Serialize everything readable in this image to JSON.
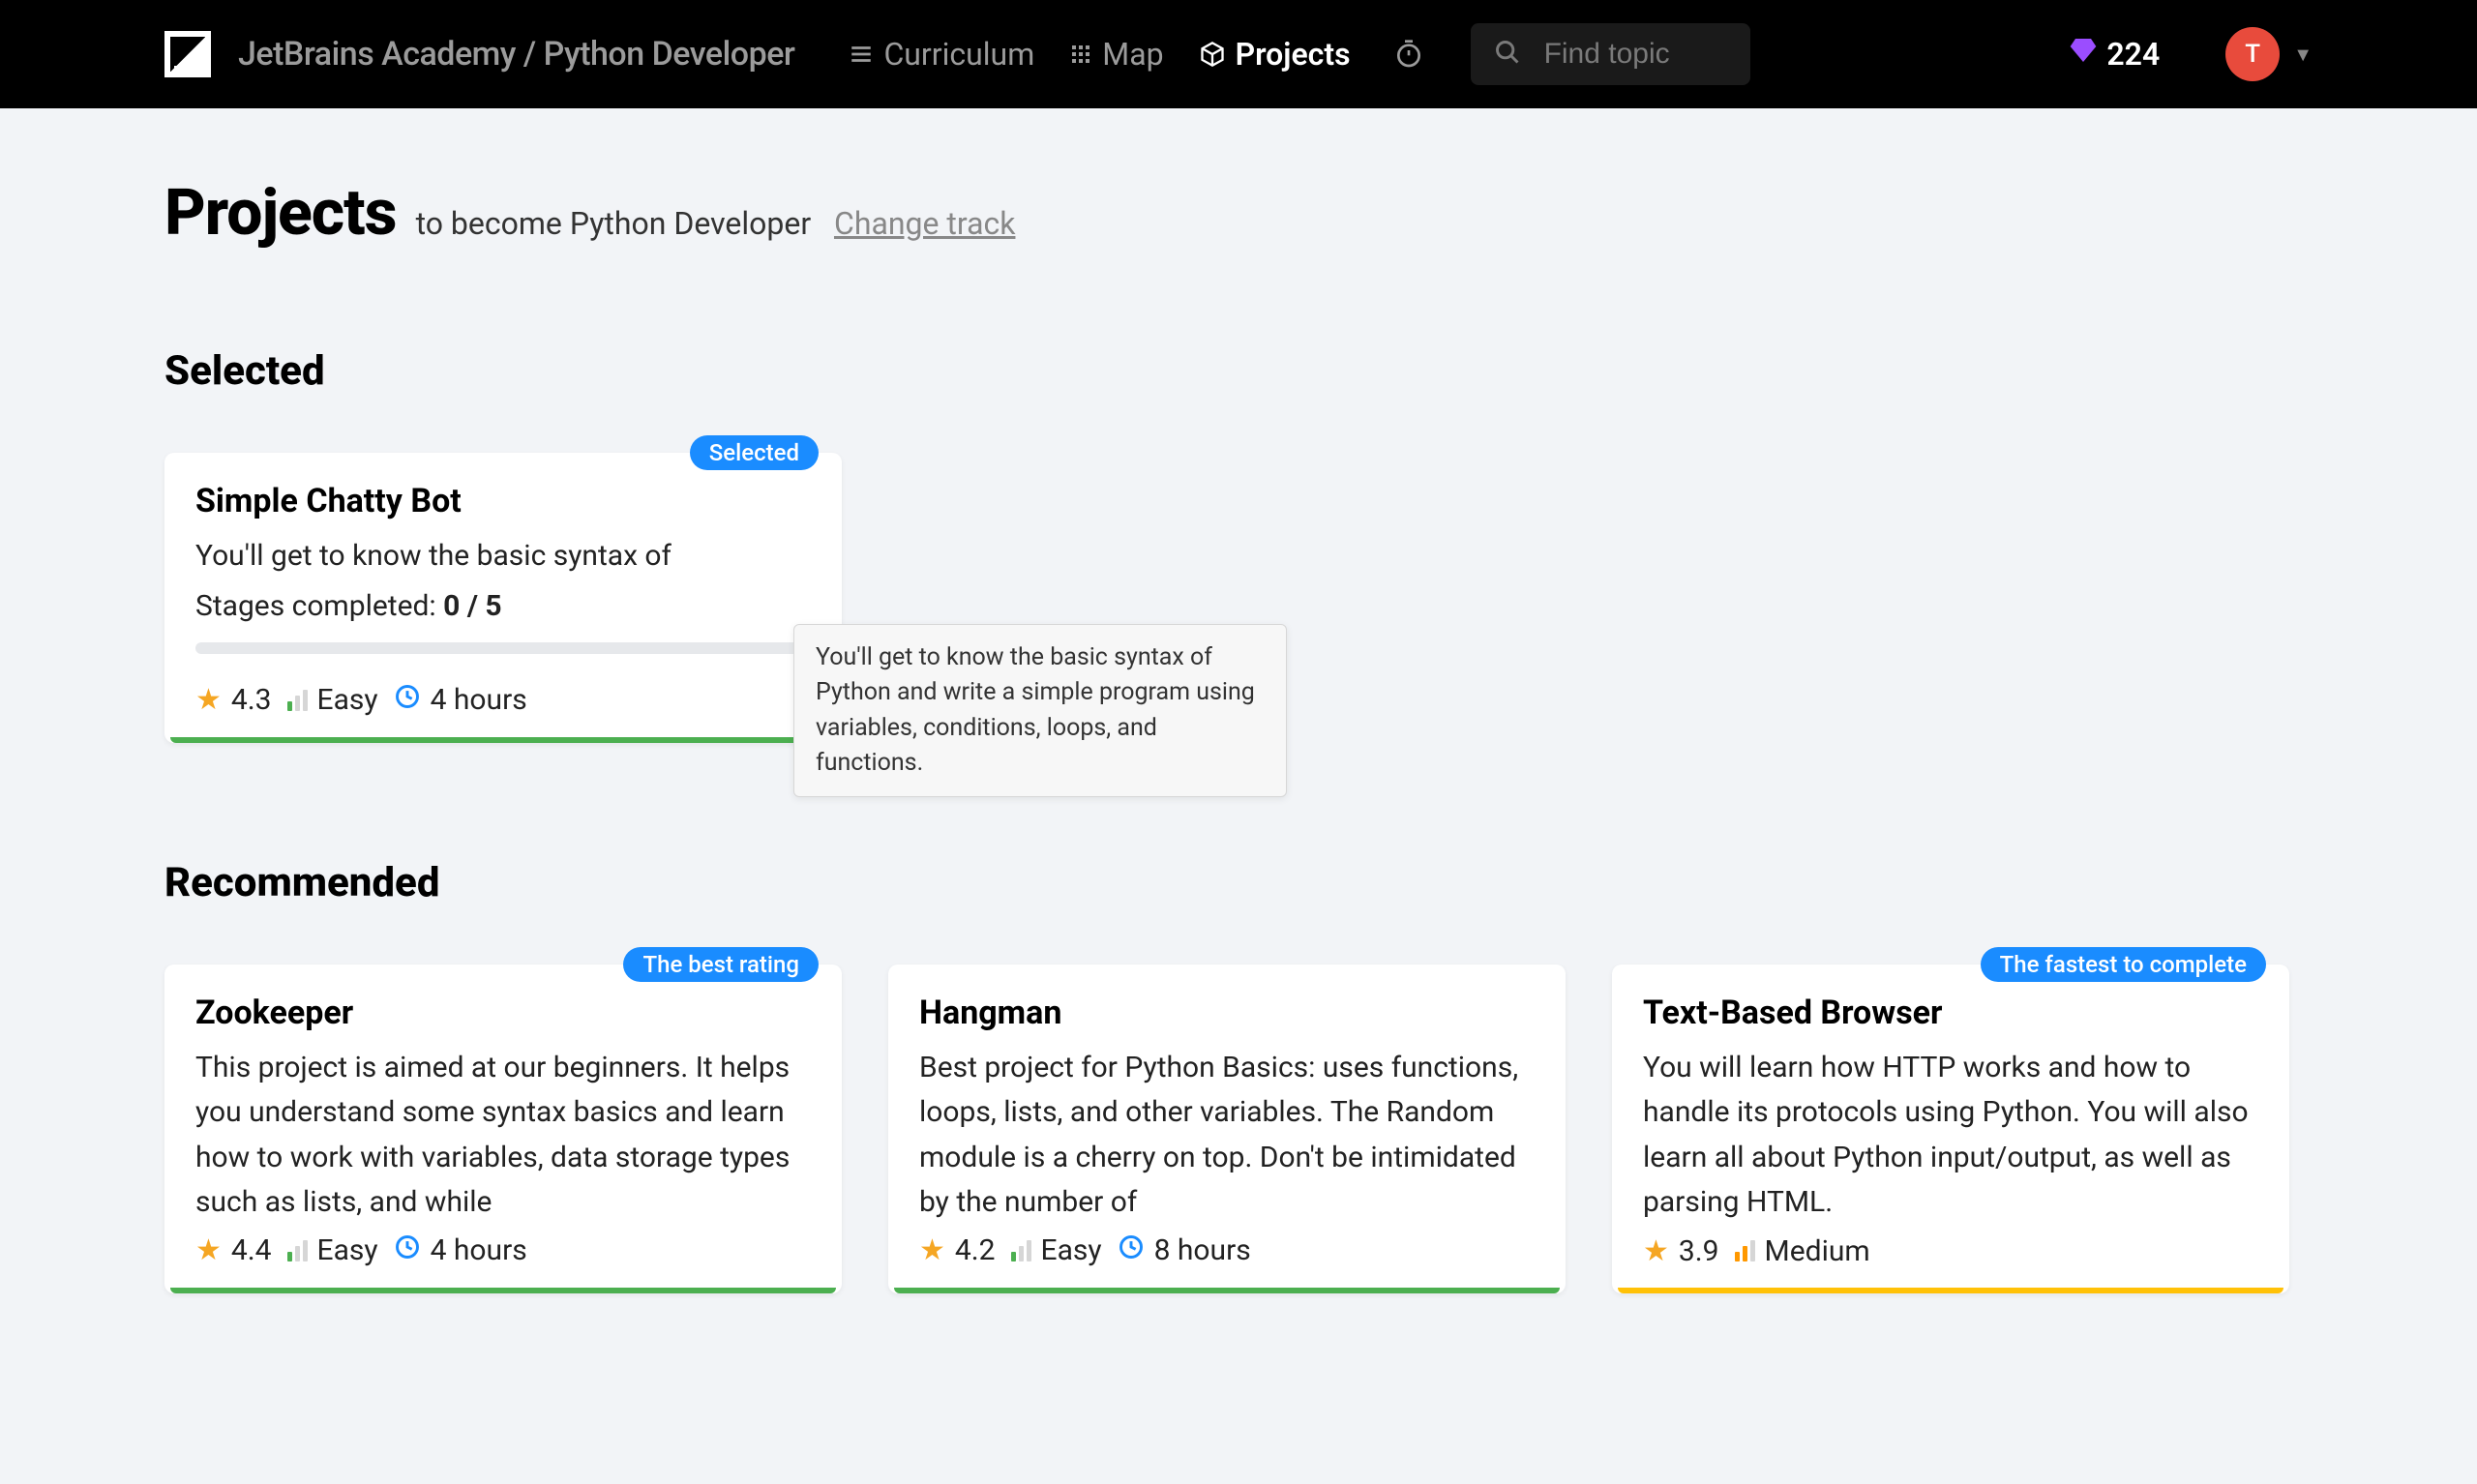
{
  "header": {
    "breadcrumb": "JetBrains Academy / Python Developer",
    "nav": {
      "curriculum": "Curriculum",
      "map": "Map",
      "projects": "Projects"
    },
    "search_placeholder": "Find topic",
    "gems": "224",
    "avatar_initial": "T"
  },
  "page": {
    "title": "Projects",
    "subtitle_prefix": "to become Python Developer",
    "change_link": "Change track"
  },
  "sections": {
    "selected": "Selected",
    "recommended": "Recommended"
  },
  "tooltip": "You'll get to know the basic syntax of Python and write a simple program using variables, conditions, loops, and functions.",
  "selected_card": {
    "badge": "Selected",
    "title": "Simple Chatty Bot",
    "desc": "You'll get to know the basic syntax of",
    "stages_label": "Stages completed:",
    "stages_value": "0 / 5",
    "rating": "4.3",
    "difficulty": "Easy",
    "time": "4 hours"
  },
  "recommended": [
    {
      "badge": "The best rating",
      "title": "Zookeeper",
      "desc": "This project is aimed at our beginners. It helps you understand some syntax basics and learn how to work with variables, data storage types such as lists, and while",
      "rating": "4.4",
      "difficulty": "Easy",
      "difficulty_level": "easy",
      "time": "4 hours",
      "bar": "green"
    },
    {
      "badge": "",
      "title": "Hangman",
      "desc": "Best project for Python Basics: uses functions, loops, lists, and other variables. The Random module is a cherry on top. Don't be intimidated by the number of",
      "rating": "4.2",
      "difficulty": "Easy",
      "difficulty_level": "easy",
      "time": "8 hours",
      "bar": "green"
    },
    {
      "badge": "The fastest to complete",
      "title": "Text-Based Browser",
      "desc": "You will learn how HTTP works and how to handle its protocols using Python. You will also learn all about Python input/output, as well as parsing HTML.",
      "rating": "3.9",
      "difficulty": "Medium",
      "difficulty_level": "medium",
      "time": "",
      "bar": "orange"
    }
  ]
}
